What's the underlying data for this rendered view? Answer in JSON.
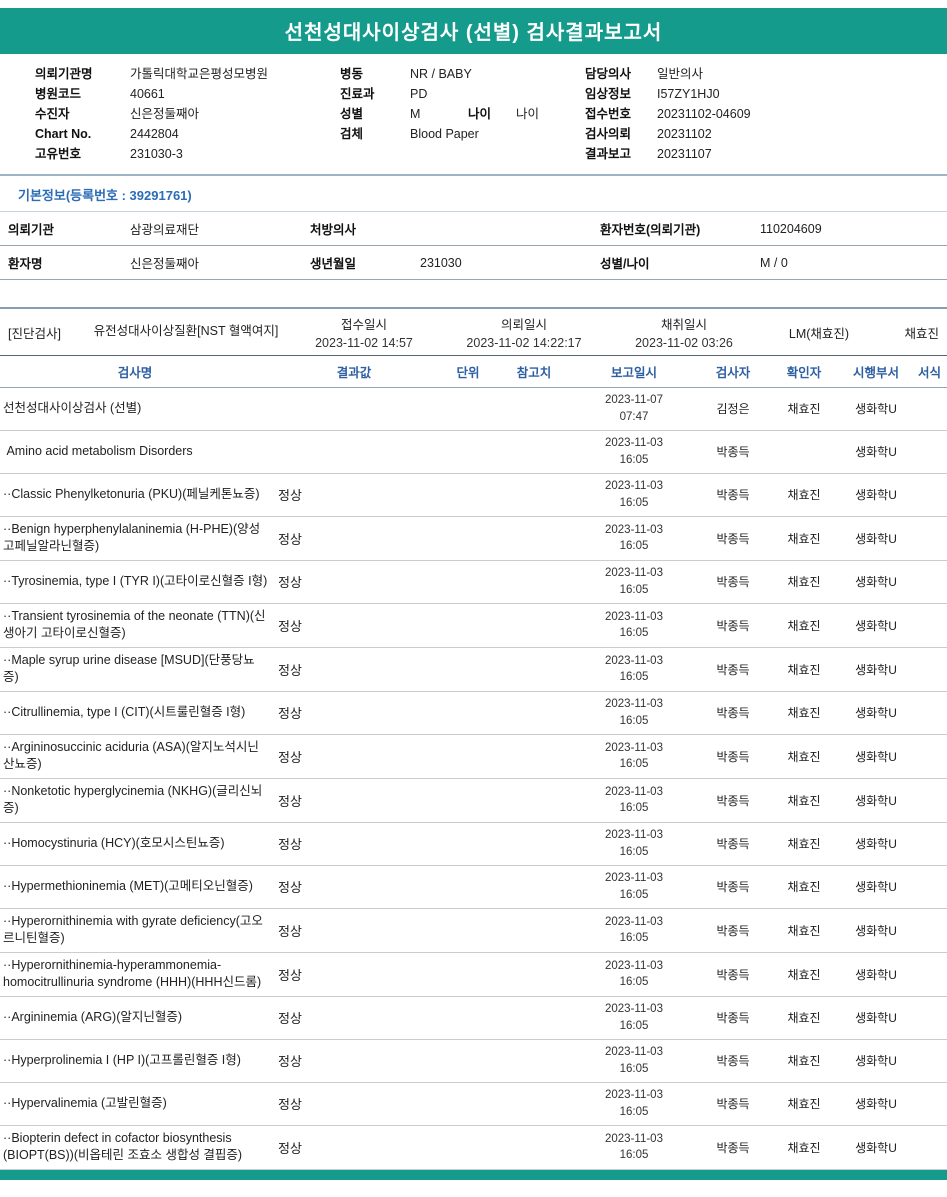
{
  "title": "선천성대사이상검사 (선별) 검사결과보고서",
  "top_info": {
    "left": [
      {
        "label": "의뢰기관명",
        "value": "가톨릭대학교은평성모병원"
      },
      {
        "label": "병원코드",
        "value": "40661"
      },
      {
        "label": "수진자",
        "value": "신은정둘째아"
      },
      {
        "label": "Chart No.",
        "value": "2442804"
      },
      {
        "label": "고유번호",
        "value": "231030-3"
      }
    ],
    "middle": [
      {
        "label": "병동",
        "value": "NR / BABY"
      },
      {
        "label": "진료과",
        "value": "PD"
      },
      {
        "label": "성별",
        "value": "M",
        "label2": "나이",
        "value2": "나이"
      },
      {
        "label": "검체",
        "value": "Blood Paper"
      }
    ],
    "right": [
      {
        "label": "담당의사",
        "value": "일반의사"
      },
      {
        "label": "임상정보",
        "value": "I57ZY1HJ0"
      },
      {
        "label": "접수번호",
        "value": "20231102-04609"
      },
      {
        "label": "검사의뢰",
        "value": "20231102"
      },
      {
        "label": "결과보고",
        "value": "20231107"
      }
    ]
  },
  "basic_info": {
    "heading": "기본정보(등록번호 : 39291761)",
    "row1": [
      {
        "label": "의뢰기관",
        "value": "삼광의료재단"
      },
      {
        "label": "처방의사",
        "value": ""
      },
      {
        "label": "환자번호(의뢰기관)",
        "value": "110204609"
      }
    ],
    "row2": [
      {
        "label": "환자명",
        "value": "신은정둘째아"
      },
      {
        "label": "생년월일",
        "value": "231030"
      },
      {
        "label": "성별/나이",
        "value": "M / 0"
      }
    ]
  },
  "exam": {
    "tag": "[진단검사]",
    "test": "유전성대사이상질환[NST 혈액여지]",
    "received_label": "접수일시",
    "received": "2023-11-02 14:57",
    "requested_label": "의뢰일시",
    "requested": "2023-11-02 14:22:17",
    "collected_label": "채취일시",
    "collected": "2023-11-02 03:26",
    "collector": "LM(채효진)",
    "collector_confirm": "채효진"
  },
  "table": {
    "headers": [
      "검사명",
      "결과값",
      "단위",
      "참고치",
      "보고일시",
      "검사자",
      "확인자",
      "시행부서",
      "서식"
    ],
    "rows": [
      {
        "name": "선천성대사이상검사 (선별)",
        "result": "",
        "date": "2023-11-07\n07:47",
        "examiner": "김정은",
        "confirmer": "채효진",
        "dept": "생화학U"
      },
      {
        "name": " Amino acid metabolism Disorders",
        "result": "",
        "date": "2023-11-03\n16:05",
        "examiner": "박종득",
        "confirmer": "",
        "dept": "생화학U"
      },
      {
        "name": "··Classic Phenylketonuria (PKU)(페닐케톤뇨증)",
        "result": "정상",
        "date": "2023-11-03\n16:05",
        "examiner": "박종득",
        "confirmer": "채효진",
        "dept": "생화학U"
      },
      {
        "name": "··Benign hyperphenylalaninemia (H-PHE)(양성 고페닐알라닌혈증)",
        "result": "정상",
        "date": "2023-11-03\n16:05",
        "examiner": "박종득",
        "confirmer": "채효진",
        "dept": "생화학U"
      },
      {
        "name": "··Tyrosinemia, type I (TYR I)(고타이로신혈증 I형)",
        "result": "정상",
        "date": "2023-11-03\n16:05",
        "examiner": "박종득",
        "confirmer": "채효진",
        "dept": "생화학U"
      },
      {
        "name": "··Transient tyrosinemia of the neonate (TTN)(신생아기 고타이로신혈증)",
        "result": "정상",
        "date": "2023-11-03\n16:05",
        "examiner": "박종득",
        "confirmer": "채효진",
        "dept": "생화학U"
      },
      {
        "name": "··Maple syrup urine disease [MSUD](단풍당뇨증)",
        "result": "정상",
        "date": "2023-11-03\n16:05",
        "examiner": "박종득",
        "confirmer": "채효진",
        "dept": "생화학U"
      },
      {
        "name": "··Citrullinemia, type I (CIT)(시트룰린혈증 I형)",
        "result": "정상",
        "date": "2023-11-03\n16:05",
        "examiner": "박종득",
        "confirmer": "채효진",
        "dept": "생화학U"
      },
      {
        "name": "··Argininosuccinic aciduria (ASA)(알지노석시닌산뇨증)",
        "result": "정상",
        "date": "2023-11-03\n16:05",
        "examiner": "박종득",
        "confirmer": "채효진",
        "dept": "생화학U"
      },
      {
        "name": "··Nonketotic hyperglycinemia (NKHG)(글리신뇌증)",
        "result": "정상",
        "date": "2023-11-03\n16:05",
        "examiner": "박종득",
        "confirmer": "채효진",
        "dept": "생화학U"
      },
      {
        "name": "··Homocystinuria (HCY)(호모시스틴뇨증)",
        "result": "정상",
        "date": "2023-11-03\n16:05",
        "examiner": "박종득",
        "confirmer": "채효진",
        "dept": "생화학U"
      },
      {
        "name": "··Hypermethioninemia (MET)(고메티오닌혈증)",
        "result": "정상",
        "date": "2023-11-03\n16:05",
        "examiner": "박종득",
        "confirmer": "채효진",
        "dept": "생화학U"
      },
      {
        "name": "··Hyperornithinemia with gyrate deficiency(고오르니틴혈증)",
        "result": "정상",
        "date": "2023-11-03\n16:05",
        "examiner": "박종득",
        "confirmer": "채효진",
        "dept": "생화학U"
      },
      {
        "name": "··Hyperornithinemia-hyperammonemia-homocitrullinuria syndrome (HHH)(HHH신드롬)",
        "result": "정상",
        "date": "2023-11-03\n16:05",
        "examiner": "박종득",
        "confirmer": "채효진",
        "dept": "생화학U"
      },
      {
        "name": "··Argininemia (ARG)(알지닌혈증)",
        "result": "정상",
        "date": "2023-11-03\n16:05",
        "examiner": "박종득",
        "confirmer": "채효진",
        "dept": "생화학U"
      },
      {
        "name": "··Hyperprolinemia I (HP I)(고프롤린혈증 I형)",
        "result": "정상",
        "date": "2023-11-03\n16:05",
        "examiner": "박종득",
        "confirmer": "채효진",
        "dept": "생화학U"
      },
      {
        "name": "··Hypervalinemia (고발린혈증)",
        "result": "정상",
        "date": "2023-11-03\n16:05",
        "examiner": "박종득",
        "confirmer": "채효진",
        "dept": "생화학U"
      },
      {
        "name": "··Biopterin defect in cofactor biosynthesis (BIOPT(BS))(비옵테린 조효소 생합성 결핍증)",
        "result": "정상",
        "date": "2023-11-03\n16:05",
        "examiner": "박종득",
        "confirmer": "채효진",
        "dept": "생화학U"
      }
    ]
  }
}
